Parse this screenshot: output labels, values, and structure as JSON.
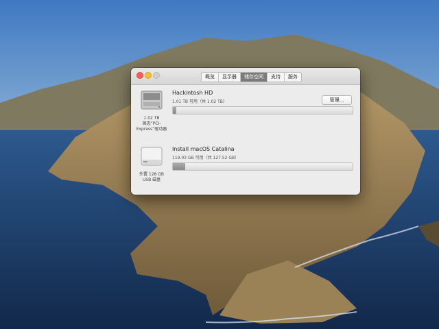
{
  "window": {
    "tabs": [
      {
        "label": "概览",
        "active": false
      },
      {
        "label": "显示器",
        "active": false
      },
      {
        "label": "储存空间",
        "active": true
      },
      {
        "label": "支持",
        "active": false
      },
      {
        "label": "服务",
        "active": false
      }
    ]
  },
  "volumes": [
    {
      "name": "Hackintosh HD",
      "capacity": "1.01 TB 可用（共 1.02 TB）",
      "disk_caption": "1.02 TB\n固态“PCI-\nExpress”驱动器",
      "used_fraction": 0.02,
      "icon": "internal-ssd-icon",
      "action_label": "管理..."
    },
    {
      "name": "Install macOS Catalina",
      "capacity": "119.03 GB 可用（共 127.52 GB）",
      "disk_caption": "外置 128 GB\nUSB 磁盘",
      "used_fraction": 0.07,
      "icon": "external-usb-disk-icon"
    }
  ],
  "colors": {
    "close": "#fc5f57",
    "minimize": "#fdbc2e",
    "active_tab": "#7b7b7b"
  }
}
